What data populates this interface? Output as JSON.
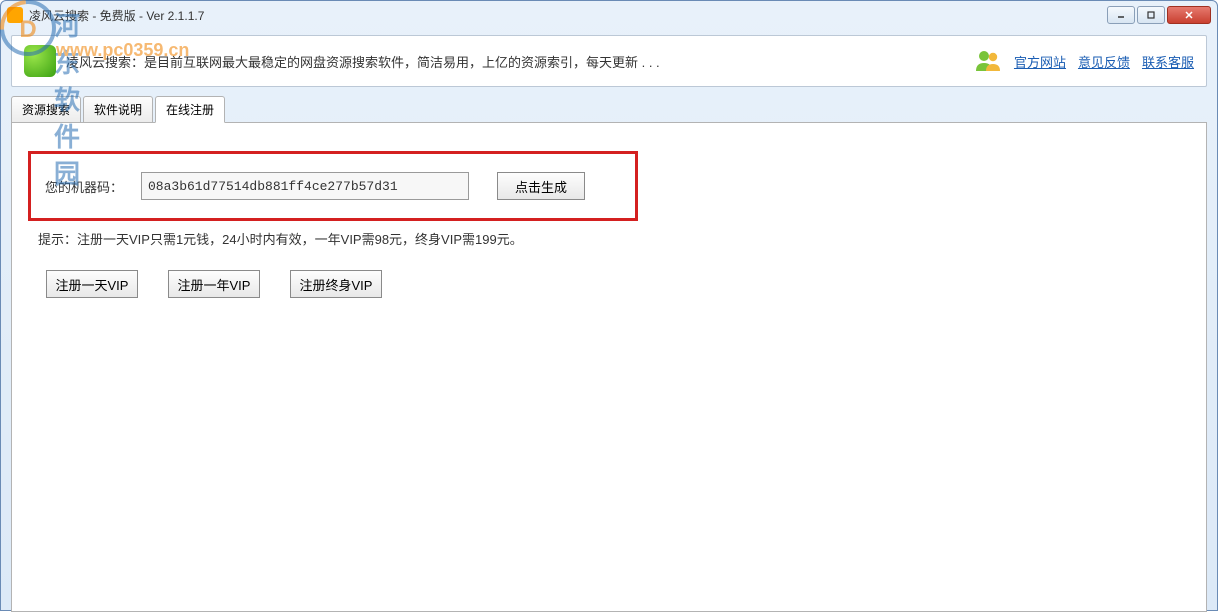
{
  "window": {
    "title": "凌风云搜索 - 免费版 - Ver 2.1.1.7"
  },
  "header": {
    "slogan": "凌风云搜索：是目前互联网最大最稳定的网盘资源搜索软件，简洁易用，上亿的资源索引，每天更新 . . .",
    "links": {
      "official": "官方网站",
      "feedback": "意见反馈",
      "support": "联系客服"
    }
  },
  "tabs": {
    "search": "资源搜索",
    "info": "软件说明",
    "register": "在线注册"
  },
  "register_panel": {
    "machine_label": "您的机器码：",
    "machine_code": "08a3b61d77514db881ff4ce277b57d31",
    "generate_btn": "点击生成",
    "hint": "提示：注册一天VIP只需1元钱，24小时内有效，一年VIP需98元，终身VIP需199元。",
    "btn_day": "注册一天VIP",
    "btn_year": "注册一年VIP",
    "btn_life": "注册终身VIP"
  },
  "watermark": {
    "site_cn": "河东软件园",
    "site_url": "www.pc0359.cn"
  }
}
